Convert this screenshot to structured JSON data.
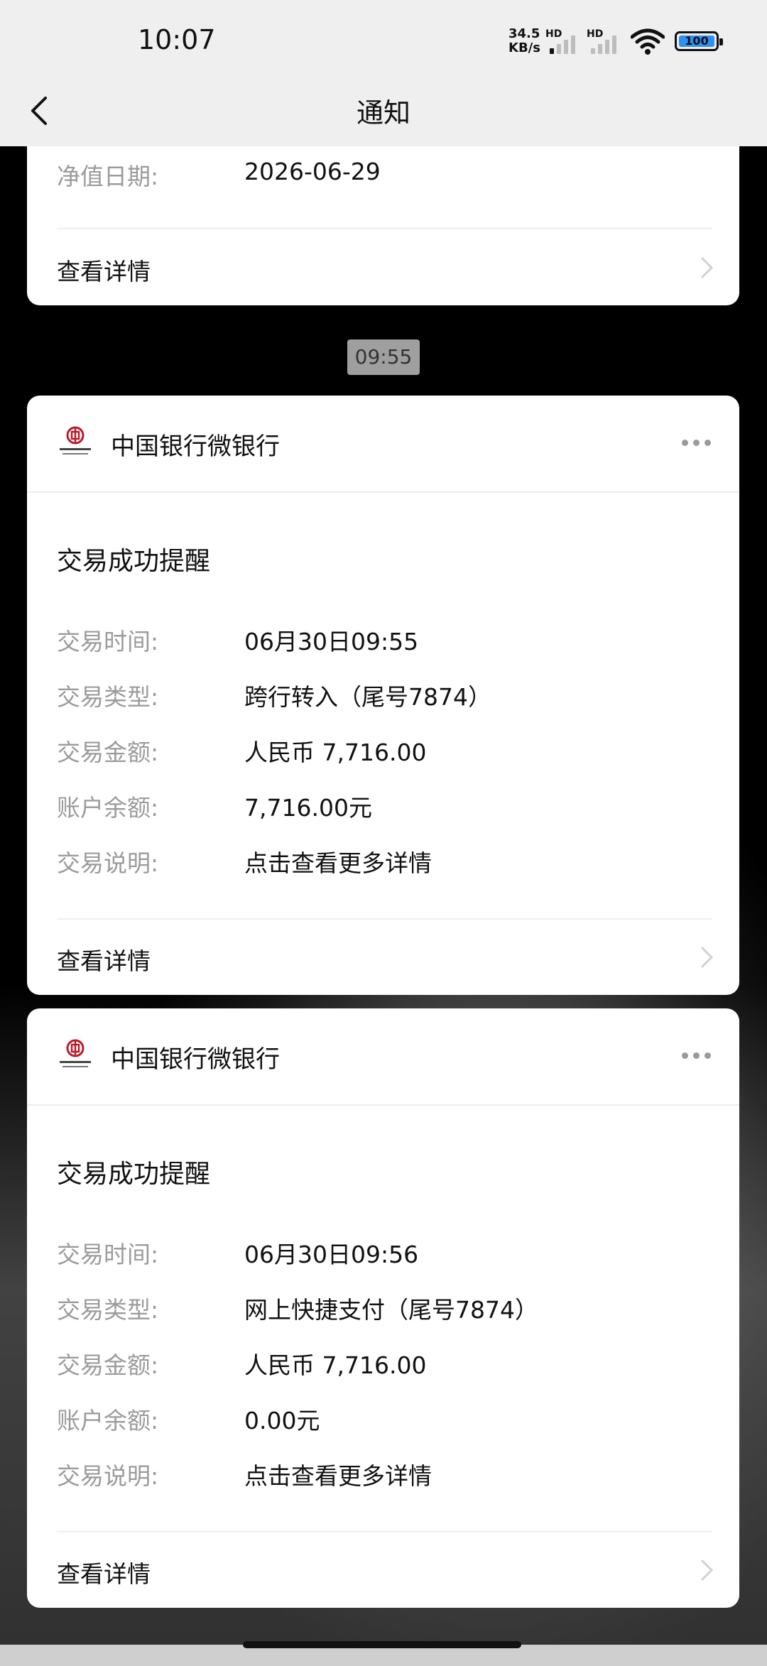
{
  "status": {
    "time": "10:07",
    "net_speed_value": "34.5",
    "net_speed_unit": "KB/s",
    "signal1_label": "HD",
    "signal2_label": "HD",
    "battery": "100",
    "battery_color": "#2f8ff5"
  },
  "nav": {
    "title": "通知",
    "back_icon": "chevron-left-icon"
  },
  "top_card": {
    "row_label": "净值日期:",
    "row_value": "2026-06-29",
    "detail_label": "查看详情"
  },
  "time_separator": "09:55",
  "notifications": [
    {
      "sender": "中国银行微银行",
      "title": "交易成功提醒",
      "rows": [
        {
          "label": "交易时间:",
          "value": "06月30日09:55"
        },
        {
          "label": "交易类型:",
          "value": "跨行转入（尾号7874）"
        },
        {
          "label": "交易金额:",
          "value": "人民币 7,716.00"
        },
        {
          "label": "账户余额:",
          "value": "7,716.00元"
        },
        {
          "label": "交易说明:",
          "value": "点击查看更多详情"
        }
      ],
      "detail_label": "查看详情"
    },
    {
      "sender": "中国银行微银行",
      "title": "交易成功提醒",
      "rows": [
        {
          "label": "交易时间:",
          "value": "06月30日09:56"
        },
        {
          "label": "交易类型:",
          "value": "网上快捷支付（尾号7874）"
        },
        {
          "label": "交易金额:",
          "value": "人民币 7,716.00"
        },
        {
          "label": "账户余额:",
          "value": "0.00元"
        },
        {
          "label": "交易说明:",
          "value": "点击查看更多详情"
        }
      ],
      "detail_label": "查看详情"
    }
  ],
  "brand_color": "#b51d2a"
}
